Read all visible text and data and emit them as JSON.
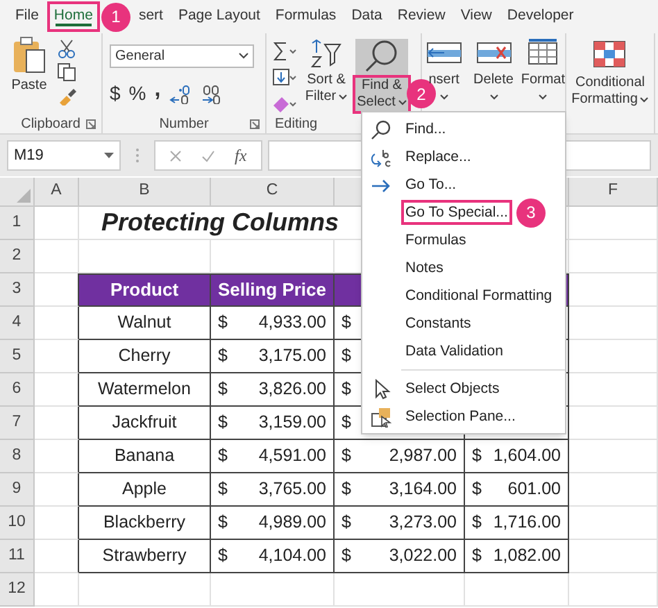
{
  "ribbon_tabs": [
    {
      "label": "File",
      "selected": false
    },
    {
      "label": "Home",
      "selected": true,
      "callout": "1"
    },
    {
      "label": "sert",
      "selected": false
    },
    {
      "label": "Page Layout",
      "selected": false
    },
    {
      "label": "Formulas",
      "selected": false
    },
    {
      "label": "Data",
      "selected": false
    },
    {
      "label": "Review",
      "selected": false
    },
    {
      "label": "View",
      "selected": false
    },
    {
      "label": "Developer",
      "selected": false
    }
  ],
  "clipboard": {
    "paste": "Paste",
    "label": "Clipboard"
  },
  "number": {
    "format": "General",
    "currency": "$",
    "percent": "%",
    "comma": ",",
    "label": "Number"
  },
  "editing": {
    "buttons": [
      {
        "line1": "Sort &",
        "line2": "Filter",
        "selected": false
      },
      {
        "line1": "Find &",
        "line2": "Select",
        "selected": true,
        "callout": "2"
      }
    ],
    "label": "Editing"
  },
  "cells": {
    "buttons": [
      "nsert",
      "Delete",
      "Format"
    ]
  },
  "styles": {
    "buttons": [
      {
        "line1": "Conditional",
        "line2": "Formatting"
      }
    ]
  },
  "formula_bar": {
    "name_box": "M19",
    "fx": "fx"
  },
  "columns": [
    "A",
    "B",
    "C",
    "F"
  ],
  "row_numbers": [
    "1",
    "2",
    "3",
    "4",
    "5",
    "6",
    "7",
    "8",
    "9",
    "10",
    "11",
    "12"
  ],
  "title": "Protecting Columns",
  "table": {
    "headers": [
      "Product",
      "Selling Price"
    ],
    "rows": [
      {
        "product": "Walnut",
        "price": {
          "sign": "$",
          "amount": "4,933.00"
        },
        "column_d": {
          "sign": "$"
        }
      },
      {
        "product": "Cherry",
        "price": {
          "sign": "$",
          "amount": "3,175.00"
        },
        "column_d": {
          "sign": "$"
        }
      },
      {
        "product": "Watermelon",
        "price": {
          "sign": "$",
          "amount": "3,826.00"
        },
        "column_d": {
          "sign": "$"
        }
      },
      {
        "product": "Jackfruit",
        "price": {
          "sign": "$",
          "amount": "3,159.00"
        },
        "column_d": {
          "sign": "$"
        }
      },
      {
        "product": "Banana",
        "price": {
          "sign": "$",
          "amount": "4,591.00"
        },
        "column_d": {
          "sign": "$",
          "amount": "2,987.00"
        },
        "column_e": {
          "sign": "$",
          "amount": "1,604.00"
        }
      },
      {
        "product": "Apple",
        "price": {
          "sign": "$",
          "amount": "3,765.00"
        },
        "column_d": {
          "sign": "$",
          "amount": "3,164.00"
        },
        "column_e": {
          "sign": "$",
          "amount": "601.00"
        }
      },
      {
        "product": "Blackberry",
        "price": {
          "sign": "$",
          "amount": "4,989.00"
        },
        "column_d": {
          "sign": "$",
          "amount": "3,273.00"
        },
        "column_e": {
          "sign": "$",
          "amount": "1,716.00"
        }
      },
      {
        "product": "Strawberry",
        "price": {
          "sign": "$",
          "amount": "4,104.00"
        },
        "column_d": {
          "sign": "$",
          "amount": "3,022.00"
        },
        "column_e": {
          "sign": "$",
          "amount": "1,082.00"
        }
      }
    ]
  },
  "menu": {
    "items": [
      {
        "label": "Find...",
        "separator_before": false
      },
      {
        "label": "Replace...",
        "separator_before": false
      },
      {
        "label": "Go To...",
        "separator_before": false
      },
      {
        "label": "Go To Special...",
        "separator_before": false,
        "callout": "3"
      },
      {
        "label": "Formulas",
        "separator_before": false
      },
      {
        "label": "Notes",
        "separator_before": false
      },
      {
        "label": "Conditional Formatting",
        "separator_before": false
      },
      {
        "label": "Constants",
        "separator_before": false
      },
      {
        "label": "Data Validation",
        "separator_before": false
      },
      {
        "label": "Select Objects",
        "separator_before": true
      },
      {
        "label": "Selection Pane...",
        "separator_before": false
      }
    ]
  }
}
